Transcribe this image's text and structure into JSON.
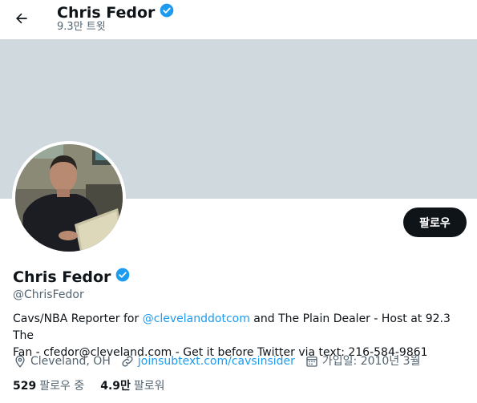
{
  "header": {
    "name": "Chris Fedor",
    "tweet_count": "9.3만 트윗"
  },
  "profile": {
    "name": "Chris Fedor",
    "handle": "@ChrisFedor",
    "follow_label": "팔로우",
    "verified_icon": "verified-badge-icon",
    "bio_prefix": "Cavs/NBA Reporter for ",
    "bio_mention": "@clevelanddotcom",
    "bio_suffix": " and The Plain Dealer - Host at 92.3 The\nFan - cfedor@cleveland.com - Get it before Twitter via text: 216-584-9861",
    "location": "Cleveland, OH",
    "website": "joinsubtext.com/cavsinsider",
    "joined": "가입일: 2010년 3월"
  },
  "stats": {
    "following_count": "529",
    "following_label": "팔로우 중",
    "followers_count": "4.9만",
    "followers_label": "팔로워"
  },
  "colors": {
    "accent": "#1d9bf0",
    "banner": "#cfd9de",
    "text_secondary": "#536471",
    "button_bg": "#0f1419"
  }
}
